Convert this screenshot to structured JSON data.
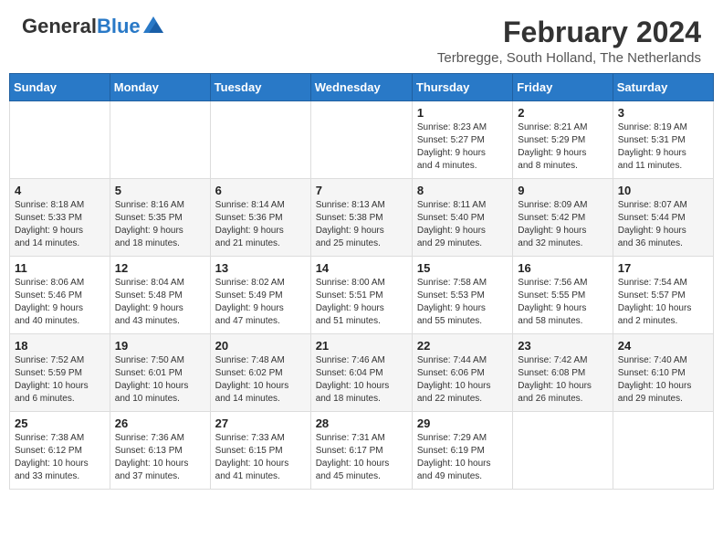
{
  "header": {
    "logo_general": "General",
    "logo_blue": "Blue",
    "month_year": "February 2024",
    "location": "Terbregge, South Holland, The Netherlands"
  },
  "weekdays": [
    "Sunday",
    "Monday",
    "Tuesday",
    "Wednesday",
    "Thursday",
    "Friday",
    "Saturday"
  ],
  "weeks": [
    [
      {
        "day": "",
        "info": ""
      },
      {
        "day": "",
        "info": ""
      },
      {
        "day": "",
        "info": ""
      },
      {
        "day": "",
        "info": ""
      },
      {
        "day": "1",
        "info": "Sunrise: 8:23 AM\nSunset: 5:27 PM\nDaylight: 9 hours\nand 4 minutes."
      },
      {
        "day": "2",
        "info": "Sunrise: 8:21 AM\nSunset: 5:29 PM\nDaylight: 9 hours\nand 8 minutes."
      },
      {
        "day": "3",
        "info": "Sunrise: 8:19 AM\nSunset: 5:31 PM\nDaylight: 9 hours\nand 11 minutes."
      }
    ],
    [
      {
        "day": "4",
        "info": "Sunrise: 8:18 AM\nSunset: 5:33 PM\nDaylight: 9 hours\nand 14 minutes."
      },
      {
        "day": "5",
        "info": "Sunrise: 8:16 AM\nSunset: 5:35 PM\nDaylight: 9 hours\nand 18 minutes."
      },
      {
        "day": "6",
        "info": "Sunrise: 8:14 AM\nSunset: 5:36 PM\nDaylight: 9 hours\nand 21 minutes."
      },
      {
        "day": "7",
        "info": "Sunrise: 8:13 AM\nSunset: 5:38 PM\nDaylight: 9 hours\nand 25 minutes."
      },
      {
        "day": "8",
        "info": "Sunrise: 8:11 AM\nSunset: 5:40 PM\nDaylight: 9 hours\nand 29 minutes."
      },
      {
        "day": "9",
        "info": "Sunrise: 8:09 AM\nSunset: 5:42 PM\nDaylight: 9 hours\nand 32 minutes."
      },
      {
        "day": "10",
        "info": "Sunrise: 8:07 AM\nSunset: 5:44 PM\nDaylight: 9 hours\nand 36 minutes."
      }
    ],
    [
      {
        "day": "11",
        "info": "Sunrise: 8:06 AM\nSunset: 5:46 PM\nDaylight: 9 hours\nand 40 minutes."
      },
      {
        "day": "12",
        "info": "Sunrise: 8:04 AM\nSunset: 5:48 PM\nDaylight: 9 hours\nand 43 minutes."
      },
      {
        "day": "13",
        "info": "Sunrise: 8:02 AM\nSunset: 5:49 PM\nDaylight: 9 hours\nand 47 minutes."
      },
      {
        "day": "14",
        "info": "Sunrise: 8:00 AM\nSunset: 5:51 PM\nDaylight: 9 hours\nand 51 minutes."
      },
      {
        "day": "15",
        "info": "Sunrise: 7:58 AM\nSunset: 5:53 PM\nDaylight: 9 hours\nand 55 minutes."
      },
      {
        "day": "16",
        "info": "Sunrise: 7:56 AM\nSunset: 5:55 PM\nDaylight: 9 hours\nand 58 minutes."
      },
      {
        "day": "17",
        "info": "Sunrise: 7:54 AM\nSunset: 5:57 PM\nDaylight: 10 hours\nand 2 minutes."
      }
    ],
    [
      {
        "day": "18",
        "info": "Sunrise: 7:52 AM\nSunset: 5:59 PM\nDaylight: 10 hours\nand 6 minutes."
      },
      {
        "day": "19",
        "info": "Sunrise: 7:50 AM\nSunset: 6:01 PM\nDaylight: 10 hours\nand 10 minutes."
      },
      {
        "day": "20",
        "info": "Sunrise: 7:48 AM\nSunset: 6:02 PM\nDaylight: 10 hours\nand 14 minutes."
      },
      {
        "day": "21",
        "info": "Sunrise: 7:46 AM\nSunset: 6:04 PM\nDaylight: 10 hours\nand 18 minutes."
      },
      {
        "day": "22",
        "info": "Sunrise: 7:44 AM\nSunset: 6:06 PM\nDaylight: 10 hours\nand 22 minutes."
      },
      {
        "day": "23",
        "info": "Sunrise: 7:42 AM\nSunset: 6:08 PM\nDaylight: 10 hours\nand 26 minutes."
      },
      {
        "day": "24",
        "info": "Sunrise: 7:40 AM\nSunset: 6:10 PM\nDaylight: 10 hours\nand 29 minutes."
      }
    ],
    [
      {
        "day": "25",
        "info": "Sunrise: 7:38 AM\nSunset: 6:12 PM\nDaylight: 10 hours\nand 33 minutes."
      },
      {
        "day": "26",
        "info": "Sunrise: 7:36 AM\nSunset: 6:13 PM\nDaylight: 10 hours\nand 37 minutes."
      },
      {
        "day": "27",
        "info": "Sunrise: 7:33 AM\nSunset: 6:15 PM\nDaylight: 10 hours\nand 41 minutes."
      },
      {
        "day": "28",
        "info": "Sunrise: 7:31 AM\nSunset: 6:17 PM\nDaylight: 10 hours\nand 45 minutes."
      },
      {
        "day": "29",
        "info": "Sunrise: 7:29 AM\nSunset: 6:19 PM\nDaylight: 10 hours\nand 49 minutes."
      },
      {
        "day": "",
        "info": ""
      },
      {
        "day": "",
        "info": ""
      }
    ]
  ]
}
